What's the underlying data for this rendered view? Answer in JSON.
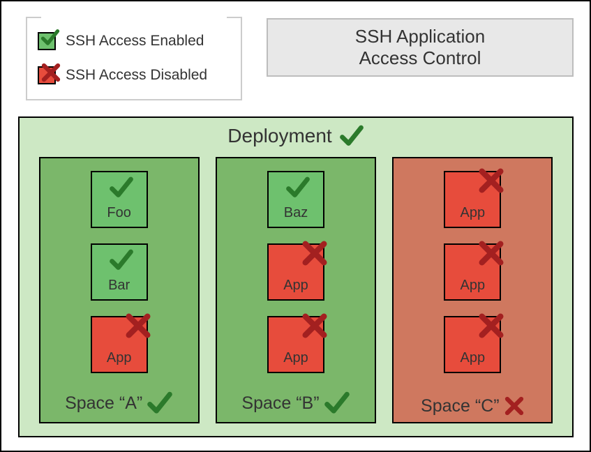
{
  "legend": {
    "enabled_label": "SSH Access Enabled",
    "disabled_label": "SSH Access Disabled"
  },
  "title": {
    "line1": "SSH Application",
    "line2": "Access Control"
  },
  "deployment": {
    "label": "Deployment",
    "status": "enabled",
    "spaces": [
      {
        "name": "Space “A”",
        "status": "enabled",
        "apps": [
          {
            "name": "Foo",
            "status": "enabled"
          },
          {
            "name": "Bar",
            "status": "enabled"
          },
          {
            "name": "App",
            "status": "disabled"
          }
        ]
      },
      {
        "name": "Space “B”",
        "status": "enabled",
        "apps": [
          {
            "name": "Baz",
            "status": "enabled"
          },
          {
            "name": "App",
            "status": "disabled"
          },
          {
            "name": "App",
            "status": "disabled"
          }
        ]
      },
      {
        "name": "Space “C”",
        "status": "disabled",
        "apps": [
          {
            "name": "App",
            "status": "disabled"
          },
          {
            "name": "App",
            "status": "disabled"
          },
          {
            "name": "App",
            "status": "disabled"
          }
        ]
      }
    ]
  },
  "colors": {
    "enabled_bg": "#6ec16e",
    "disabled_bg": "#e74c3c",
    "space_enabled": "#7bb76a",
    "space_disabled": "#cf785f",
    "deployment_bg": "#cde8c4",
    "check": "#2b7a2b",
    "cross": "#a32020"
  }
}
